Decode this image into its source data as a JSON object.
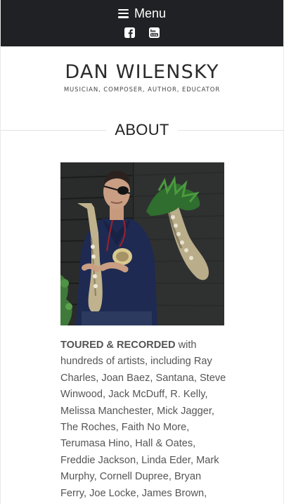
{
  "header": {
    "menu_label": "Menu",
    "social": [
      {
        "icon": "facebook-icon",
        "glyph": "f"
      },
      {
        "icon": "youtube-icon",
        "glyph": "You Tube"
      }
    ]
  },
  "site": {
    "title": "DAN WILENSKY",
    "tagline": "MUSICIAN, COMPOSER, AUTHOR, EDUCATOR"
  },
  "section": {
    "heading": "ABOUT"
  },
  "bio": {
    "lead": "TOURED & RECORDED",
    "text": " with hundreds of artists, including Ray Charles, Joan Baez, Santana, Steve Winwood, Jack McDuff, R. Kelly, Melissa Manchester, Mick Jagger, The Roches, Faith No More, Terumasa Hino, Hall & Oates, Freddie Jackson, Linda Eder, Mark Murphy, Cornell Dupree, Bryan Ferry, Joe Locke, James Brown,"
  },
  "colors": {
    "topbar": "#1f2124",
    "text": "#555555",
    "heading": "#222222"
  }
}
